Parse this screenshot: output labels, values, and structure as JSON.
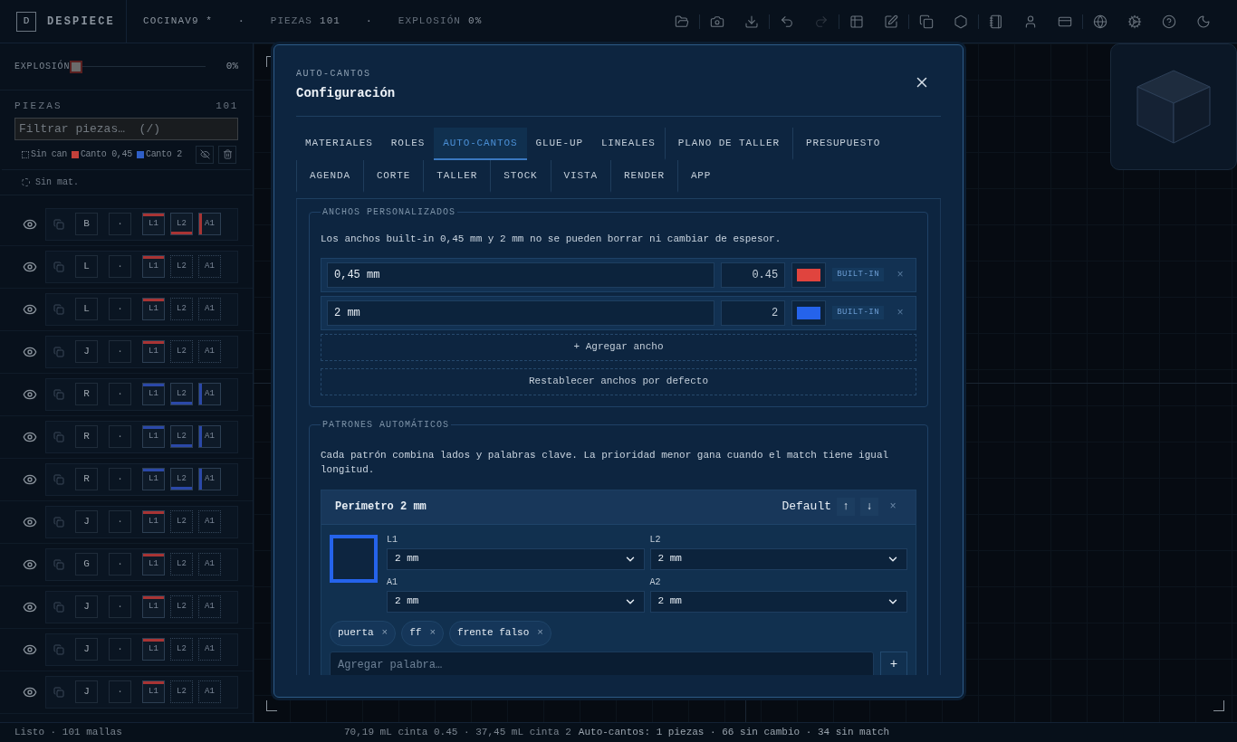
{
  "topbar": {
    "logo": "D",
    "app_name": "DESPIECE",
    "project": "COCINAV9 *",
    "stats": [
      {
        "separator": "·",
        "label": "PIEZAS",
        "value": "101"
      },
      {
        "separator": "·",
        "label": "EXPLOSIÓN",
        "value": "0%"
      }
    ],
    "tool_groups": [
      {
        "tools": [
          {
            "kind": "folder",
            "disabled": false
          }
        ]
      },
      {
        "tools": [
          {
            "kind": "camera",
            "disabled": false
          },
          {
            "kind": "download",
            "disabled": false
          }
        ]
      },
      {
        "tools": [
          {
            "kind": "undo",
            "disabled": false
          },
          {
            "kind": "redo",
            "disabled": true
          }
        ]
      },
      {
        "tools": [
          {
            "kind": "grid",
            "disabled": false
          },
          {
            "kind": "edit",
            "disabled": false
          }
        ]
      },
      {
        "tools": [
          {
            "kind": "copy",
            "disabled": false
          },
          {
            "kind": "nut",
            "disabled": false
          }
        ]
      },
      {
        "tools": [
          {
            "kind": "notebook",
            "disabled": false
          },
          {
            "kind": "user",
            "disabled": false
          },
          {
            "kind": "card",
            "disabled": false
          }
        ]
      },
      {
        "tools": [
          {
            "kind": "globe",
            "disabled": false
          },
          {
            "kind": "cog",
            "disabled": false
          },
          {
            "kind": "help",
            "disabled": false
          },
          {
            "kind": "moon",
            "disabled": false
          }
        ]
      }
    ]
  },
  "sidebar": {
    "explosion": {
      "label": "EXPLOSIÓN",
      "level": 0,
      "reading": "0%"
    },
    "pieces_title": "PIEZAS",
    "pieces_count": "101",
    "filter_placeholder": "Filtrar piezas…  (/)",
    "legend": [
      {
        "kind": "none",
        "label": "Sin can"
      },
      {
        "kind": "swatch",
        "label": "Canto 0,45",
        "color": "#c2403a"
      },
      {
        "kind": "swatch",
        "label": "Canto 2",
        "color": "#2f5fc8"
      }
    ],
    "no_material": "Sin mat.",
    "pieces": [
      {
        "letter": "B",
        "mark": "·",
        "edges": [
          {
            "label": "L1",
            "banded": true,
            "color": "#a83434"
          },
          {
            "label": "L2",
            "banded": true,
            "color": "#a83434"
          },
          {
            "label": "A1",
            "banded": true,
            "color": "#a83434"
          }
        ]
      },
      {
        "letter": "L",
        "mark": "·",
        "edges": [
          {
            "label": "L1",
            "banded": true,
            "color": "#a83434"
          },
          {
            "label": "L2",
            "banded": false
          },
          {
            "label": "A1",
            "banded": false
          }
        ]
      },
      {
        "letter": "L",
        "mark": "·",
        "edges": [
          {
            "label": "L1",
            "banded": true,
            "color": "#a83434"
          },
          {
            "label": "L2",
            "banded": false
          },
          {
            "label": "A1",
            "banded": false
          }
        ]
      },
      {
        "letter": "J",
        "mark": "·",
        "edges": [
          {
            "label": "L1",
            "banded": true,
            "color": "#a83434"
          },
          {
            "label": "L2",
            "banded": false
          },
          {
            "label": "A1",
            "banded": false
          }
        ]
      },
      {
        "letter": "R",
        "mark": "·",
        "edges": [
          {
            "label": "L1",
            "banded": true,
            "color": "#2b48a8"
          },
          {
            "label": "L2",
            "banded": true,
            "color": "#2b48a8"
          },
          {
            "label": "A1",
            "banded": true,
            "color": "#2b48a8"
          }
        ]
      },
      {
        "letter": "R",
        "mark": "·",
        "edges": [
          {
            "label": "L1",
            "banded": true,
            "color": "#2b48a8"
          },
          {
            "label": "L2",
            "banded": true,
            "color": "#2b48a8"
          },
          {
            "label": "A1",
            "banded": true,
            "color": "#2b48a8"
          }
        ]
      },
      {
        "letter": "R",
        "mark": "·",
        "edges": [
          {
            "label": "L1",
            "banded": true,
            "color": "#2b48a8"
          },
          {
            "label": "L2",
            "banded": true,
            "color": "#2b48a8"
          },
          {
            "label": "A1",
            "banded": true,
            "color": "#2b48a8"
          }
        ]
      },
      {
        "letter": "J",
        "mark": "·",
        "edges": [
          {
            "label": "L1",
            "banded": true,
            "color": "#a83434"
          },
          {
            "label": "L2",
            "banded": false
          },
          {
            "label": "A1",
            "banded": false
          }
        ]
      },
      {
        "letter": "G",
        "mark": "·",
        "edges": [
          {
            "label": "L1",
            "banded": true,
            "color": "#a83434"
          },
          {
            "label": "L2",
            "banded": false
          },
          {
            "label": "A1",
            "banded": false
          }
        ]
      },
      {
        "letter": "J",
        "mark": "·",
        "edges": [
          {
            "label": "L1",
            "banded": true,
            "color": "#a83434"
          },
          {
            "label": "L2",
            "banded": false
          },
          {
            "label": "A1",
            "banded": false
          }
        ]
      },
      {
        "letter": "J",
        "mark": "·",
        "edges": [
          {
            "label": "L1",
            "banded": true,
            "color": "#a83434"
          },
          {
            "label": "L2",
            "banded": false
          },
          {
            "label": "A1",
            "banded": false
          }
        ]
      },
      {
        "letter": "J",
        "mark": "·",
        "edges": [
          {
            "label": "L1",
            "banded": true,
            "color": "#a83434"
          },
          {
            "label": "L2",
            "banded": false
          },
          {
            "label": "A1",
            "banded": false
          }
        ]
      }
    ]
  },
  "dialog": {
    "eyebrow": "AUTO-CANTOS",
    "title": "Configuración",
    "tab_rows": [
      {
        "tabs": [
          {
            "label": "MATERIALES",
            "kind": "plain",
            "selected": false
          },
          {
            "label": "ROLES",
            "kind": "plain",
            "selected": false
          },
          {
            "label": "AUTO-CANTOS",
            "kind": "plain",
            "selected": true
          },
          {
            "label": "GLUE-UP",
            "kind": "plain",
            "selected": false
          },
          {
            "label": "LINEALES",
            "kind": "plain",
            "selected": false
          },
          {
            "label": "PLANO DE TALLER",
            "kind": "divided",
            "selected": false
          },
          {
            "label": "PRESUPUESTO",
            "kind": "divided",
            "selected": false
          }
        ]
      },
      {
        "tabs": [
          {
            "label": "AGENDA",
            "kind": "divided",
            "selected": false
          },
          {
            "label": "CORTE",
            "kind": "divided",
            "selected": false
          },
          {
            "label": "TALLER",
            "kind": "divided",
            "selected": false
          },
          {
            "label": "STOCK",
            "kind": "divided",
            "selected": false
          },
          {
            "label": "VISTA",
            "kind": "divided",
            "selected": false
          },
          {
            "label": "RENDER",
            "kind": "divided",
            "selected": false
          },
          {
            "label": "APP",
            "kind": "divided",
            "selected": false
          }
        ]
      }
    ],
    "sections": [
      {
        "kind": "widths",
        "legend": "ANCHOS PERSONALIZADOS",
        "note": "Los anchos built-in 0,45 mm y 2 mm no se pueden borrar ni cambiar de espesor.",
        "widths": [
          {
            "name": "0,45 mm",
            "value": "0.45",
            "color": "#e0443e",
            "badge": "BUILT-IN",
            "remove": "×",
            "disabled": true
          },
          {
            "name": "2 mm",
            "value": "2",
            "color": "#2563eb",
            "badge": "BUILT-IN",
            "remove": "×",
            "disabled": true
          }
        ],
        "actions": [
          "+ Agregar ancho",
          "Restablecer anchos por defecto"
        ]
      },
      {
        "kind": "patterns",
        "legend": "PATRONES AUTOMÁTICOS",
        "note": "Cada patrón combina lados y palabras clave. La prioridad menor gana cuando el match tiene igual longitud.",
        "patterns": [
          {
            "name": "Perímetro 2 mm",
            "badge": "Default",
            "up": "↑",
            "down": "↓",
            "remove": "×",
            "sides": [
              {
                "label": "L1",
                "value": "2 mm",
                "color": "#2563eb"
              },
              {
                "label": "L2",
                "value": "2 mm",
                "color": "#2563eb"
              },
              {
                "label": "A1",
                "value": "2 mm",
                "color": "#2563eb"
              },
              {
                "label": "A2",
                "value": "2 mm",
                "color": "#2563eb"
              }
            ],
            "keywords": [
              {
                "text": "puerta",
                "remove": "×"
              },
              {
                "text": "ff",
                "remove": "×"
              },
              {
                "text": "frente falso",
                "remove": "×"
              }
            ],
            "keyword_placeholder": "Agregar palabra…",
            "add": "+"
          }
        ]
      }
    ]
  },
  "status_bar": {
    "left": "Listo · 101 mallas",
    "center": "70,19 mL cinta 0.45 · 37,45 mL cinta 2",
    "right": "Auto-cantos: 1 piezas · 66 sin cambio · 34 sin match"
  }
}
